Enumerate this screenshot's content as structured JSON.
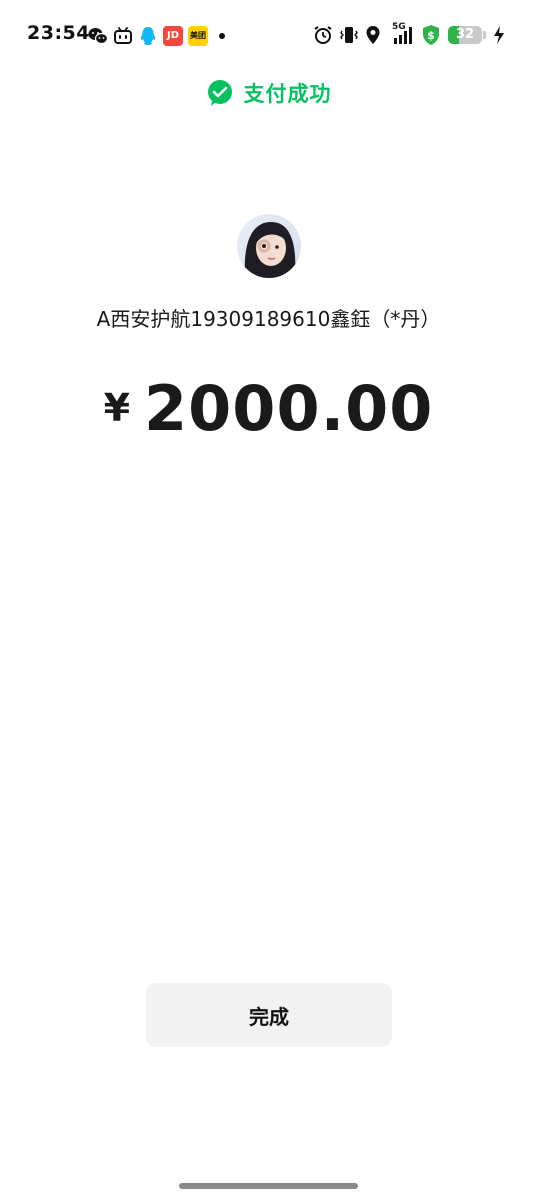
{
  "status_bar": {
    "time": "23:54",
    "notification_icons": [
      "wechat-icon",
      "bilibili-icon",
      "qq-icon",
      "jd-icon",
      "meituan-icon",
      "notification-dot-icon"
    ],
    "jd_badge": "JD",
    "meituan_badge": "美团",
    "network": "5G",
    "battery": "32",
    "battery_level": 0.32,
    "charging": true
  },
  "header": {
    "title": "支付成功",
    "icon": "wechat-pay-check-icon",
    "accent_color": "#07c160"
  },
  "payee": {
    "name": "A西安护航19309189610鑫鈺（*丹）"
  },
  "payment": {
    "currency": "¥",
    "amount": "2000.00"
  },
  "actions": {
    "done_label": "完成"
  }
}
